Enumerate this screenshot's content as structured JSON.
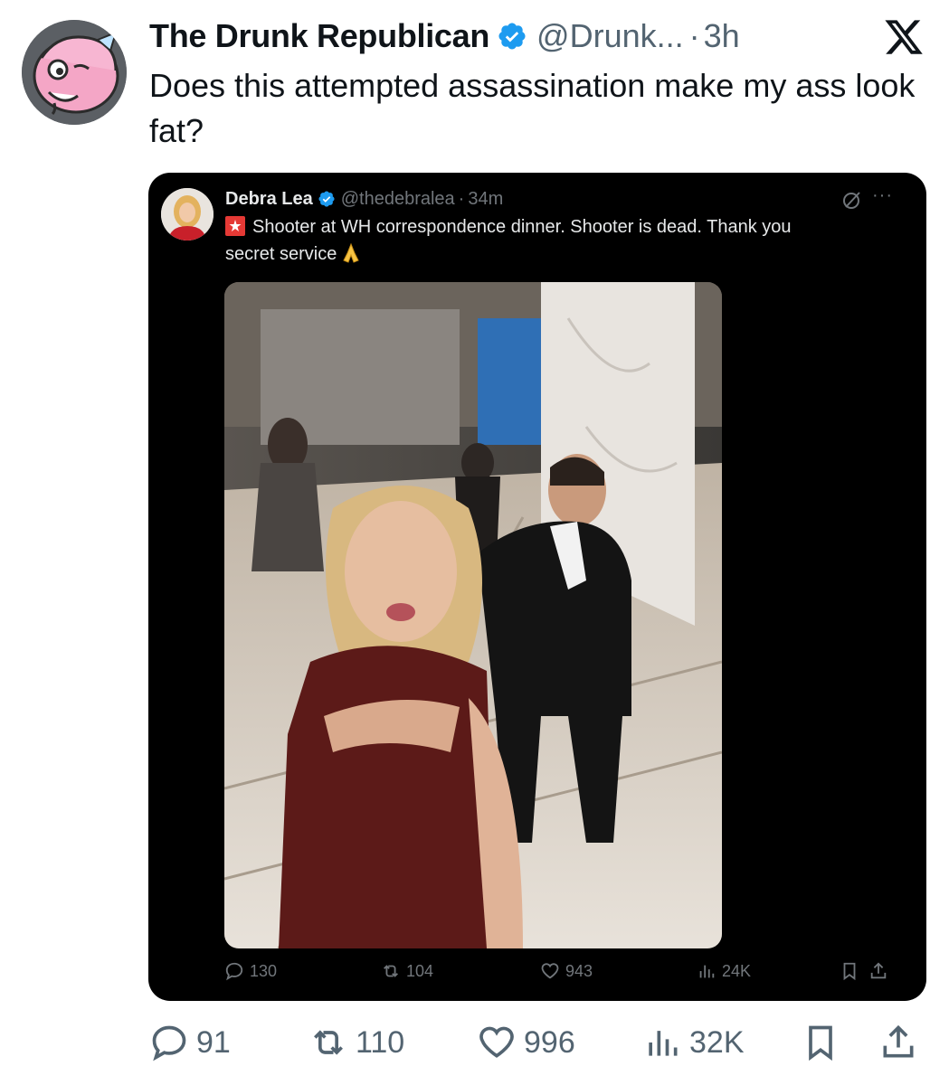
{
  "post": {
    "display_name": "The Drunk Republican",
    "handle": "@Drunk...",
    "separator": "·",
    "time": "3h",
    "text": "Does this attempted assassination make my ass look fat?",
    "verified_icon": "verified-badge-icon",
    "platform_logo": "x-logo"
  },
  "quoted": {
    "display_name": "Debra Lea",
    "handle": "@thedebralea",
    "separator": "·",
    "time": "34m",
    "more": "···",
    "text_line1": "Shooter at WH correspondence dinner. Shooter is dead. Thank you",
    "text_line2": "secret service",
    "icons": [
      "siren-emoji",
      "pray-emoji",
      "grok-icon",
      "more-icon"
    ],
    "actions": {
      "replies": "130",
      "reposts": "104",
      "likes": "943",
      "views": "24K"
    }
  },
  "actions": {
    "replies": "91",
    "reposts": "110",
    "likes": "996",
    "views": "32K"
  },
  "colors": {
    "verified": "#1d9bf0",
    "secondary_text": "#536471",
    "quote_background": "#000000",
    "quote_secondary": "#71767b"
  }
}
